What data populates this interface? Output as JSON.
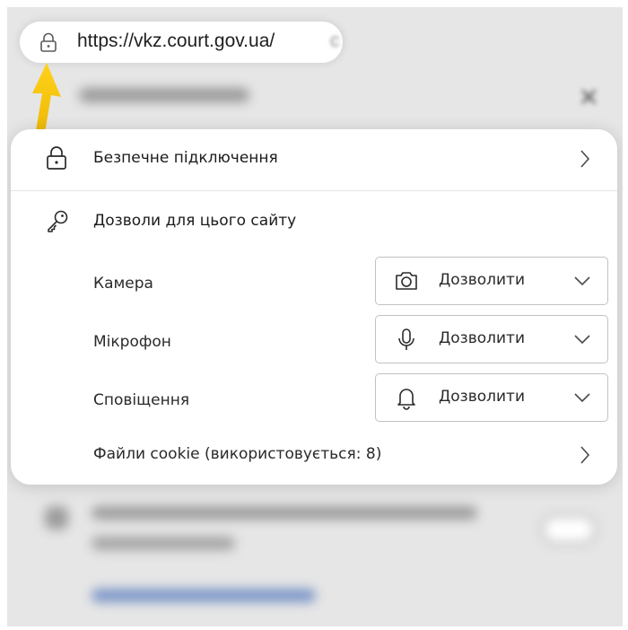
{
  "address_bar": {
    "url": "https://vkz.court.gov.ua/",
    "url_trail": "c",
    "lock_icon": "lock-icon"
  },
  "panel": {
    "secure_connection": {
      "label": "Безпечне підключення",
      "icon": "lock-icon"
    },
    "permissions": {
      "title": "Дозволи для цього сайту",
      "icon": "key-icon",
      "items": [
        {
          "label": "Камера",
          "value": "Дозволити",
          "icon": "camera-icon"
        },
        {
          "label": "Мікрофон",
          "value": "Дозволити",
          "icon": "microphone-icon"
        },
        {
          "label": "Сповіщення",
          "value": "Дозволити",
          "icon": "bell-icon"
        }
      ]
    },
    "cookies": {
      "label": "Файли cookie (використовується: 8)"
    }
  },
  "colors": {
    "arrow": "#f5c400",
    "panel_bg": "#ffffff",
    "backdrop": "#e6e6e6"
  }
}
